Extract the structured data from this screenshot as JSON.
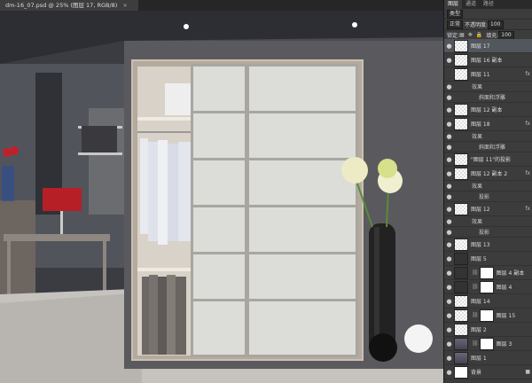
{
  "document": {
    "tab_title": "dm-16_07.psd @ 25% (图层 17, RGB/8)",
    "close": "×"
  },
  "panel": {
    "tabs": [
      "图层",
      "通道",
      "路径"
    ],
    "filter_kind": "类型",
    "blend_mode": "正常",
    "opacity_label": "不透明度:",
    "opacity_value": "100",
    "lock_label": "锁定:",
    "fill_label": "填充:",
    "fill_value": "100",
    "layers": [
      {
        "name": "图层 17",
        "selected": true,
        "thumb": "checker",
        "type": "layer"
      },
      {
        "name": "图层 16 副本",
        "thumb": "checker",
        "type": "layer"
      },
      {
        "name": "图层 11",
        "thumb": "checker",
        "type": "layer",
        "hidden": true,
        "fx": "fx"
      },
      {
        "name": "效果",
        "type": "effects"
      },
      {
        "name": "斜面和浮雕",
        "type": "effect"
      },
      {
        "name": "图层 12 副本",
        "thumb": "checker",
        "type": "layer"
      },
      {
        "name": "图层 18",
        "thumb": "checker",
        "type": "layer",
        "fx": "fx"
      },
      {
        "name": "效果",
        "type": "effects"
      },
      {
        "name": "斜面和浮雕",
        "type": "effect"
      },
      {
        "name": "\"图层 11\"的投影",
        "thumb": "checker",
        "type": "layer"
      },
      {
        "name": "图层 12 副本 2",
        "thumb": "checker",
        "type": "layer",
        "fx": "fx"
      },
      {
        "name": "效果",
        "type": "effects"
      },
      {
        "name": "投影",
        "type": "effect"
      },
      {
        "name": "图层 12",
        "thumb": "checker",
        "type": "layer",
        "fx": "fx"
      },
      {
        "name": "效果",
        "type": "effects"
      },
      {
        "name": "投影",
        "type": "effect"
      },
      {
        "name": "图层 13",
        "thumb": "checker",
        "type": "layer"
      },
      {
        "name": "图层 5",
        "thumb": "dark",
        "type": "layer"
      },
      {
        "name": "图层 4 副本",
        "thumb": "dark",
        "type": "masked"
      },
      {
        "name": "图层 4",
        "thumb": "dark",
        "type": "masked"
      },
      {
        "name": "图层 14",
        "thumb": "checker",
        "type": "layer"
      },
      {
        "name": "图层 15",
        "thumb": "checker",
        "type": "masked"
      },
      {
        "name": "图层 2",
        "thumb": "checker",
        "type": "layer"
      },
      {
        "name": "图层 3",
        "thumb": "photo",
        "type": "masked"
      },
      {
        "name": "图层 1",
        "thumb": "photo",
        "type": "layer"
      },
      {
        "name": "背景",
        "thumb": "white",
        "type": "layer",
        "locked": true
      }
    ]
  },
  "colors": {
    "panel_bg": "#3c3c3c",
    "selected_layer": "#52575e",
    "wall": "#55555a",
    "door_panel": "#dcdcd8",
    "flower": "#eeeec0"
  },
  "icons": {
    "eye": "👁",
    "lock": "🔒",
    "link": "∞"
  }
}
